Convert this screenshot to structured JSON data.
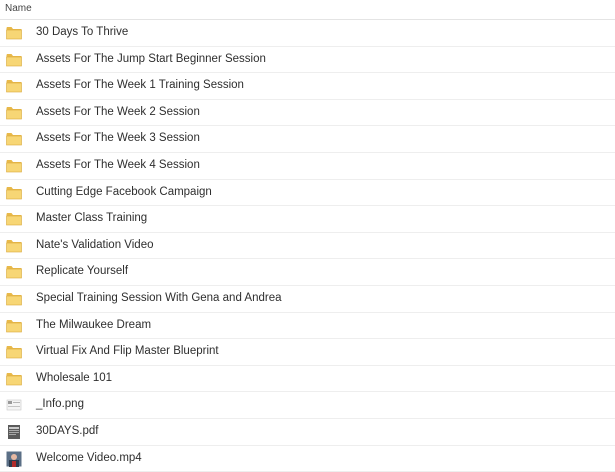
{
  "header": {
    "name_label": "Name"
  },
  "items": [
    {
      "label": "30 Days To Thrive",
      "type": "folder",
      "icon": "folder-icon"
    },
    {
      "label": "Assets For The Jump Start Beginner Session",
      "type": "folder",
      "icon": "folder-icon"
    },
    {
      "label": "Assets For The Week 1 Training Session",
      "type": "folder",
      "icon": "folder-icon"
    },
    {
      "label": "Assets For The Week 2 Session",
      "type": "folder",
      "icon": "folder-icon"
    },
    {
      "label": "Assets For The Week 3 Session",
      "type": "folder",
      "icon": "folder-icon"
    },
    {
      "label": "Assets For The Week 4 Session",
      "type": "folder",
      "icon": "folder-icon"
    },
    {
      "label": "Cutting Edge Facebook Campaign",
      "type": "folder",
      "icon": "folder-icon"
    },
    {
      "label": "Master Class Training",
      "type": "folder",
      "icon": "folder-icon"
    },
    {
      "label": "Nate's Validation Video",
      "type": "folder",
      "icon": "folder-icon"
    },
    {
      "label": "Replicate Yourself",
      "type": "folder",
      "icon": "folder-icon"
    },
    {
      "label": "Special Training Session With Gena and Andrea",
      "type": "folder",
      "icon": "folder-icon"
    },
    {
      "label": "The Milwaukee Dream",
      "type": "folder",
      "icon": "folder-icon"
    },
    {
      "label": "Virtual Fix And Flip Master Blueprint",
      "type": "folder",
      "icon": "folder-icon"
    },
    {
      "label": "Wholesale 101",
      "type": "folder",
      "icon": "folder-icon"
    },
    {
      "label": "_Info.png",
      "type": "image",
      "icon": "image-thumbnail-icon"
    },
    {
      "label": "30DAYS.pdf",
      "type": "pdf",
      "icon": "pdf-thumbnail-icon"
    },
    {
      "label": "Welcome Video.mp4",
      "type": "video",
      "icon": "video-thumbnail-icon"
    }
  ],
  "colors": {
    "folder_back": "#e8b94a",
    "folder_front": "#f7d675",
    "row_divider": "#eeeeee",
    "text": "#2e2e2e"
  }
}
